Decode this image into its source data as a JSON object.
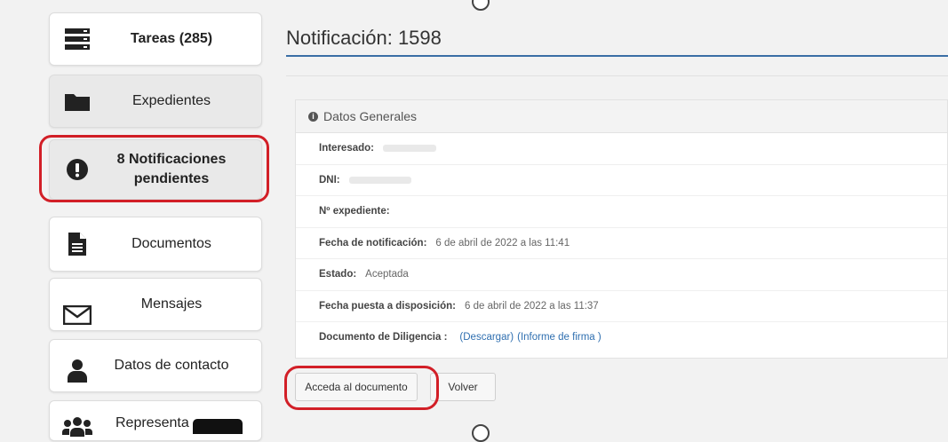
{
  "sidebar": {
    "items": [
      {
        "label": "Tareas (285)",
        "icon": "server-icon",
        "bold": true
      },
      {
        "label": "Expedientes",
        "icon": "folder-icon"
      },
      {
        "label": "8 Notificaciones pendientes",
        "icon": "exclamation-icon",
        "bold": true
      },
      {
        "label": "Documentos",
        "icon": "document-icon"
      },
      {
        "label": "Mensajes",
        "icon": "envelope-icon"
      },
      {
        "label": "Datos de contacto",
        "icon": "user-icon"
      },
      {
        "label": "Representa",
        "icon": "users-icon"
      }
    ]
  },
  "main": {
    "title": "Notificación: 1598",
    "panel_title": "Datos Generales",
    "fields": {
      "interesado_label": "Interesado:",
      "dni_label": "DNI:",
      "expediente_label": "Nº expediente:",
      "fecha_notif_label": "Fecha de notificación:",
      "fecha_notif_value": "6 de abril de 2022 a las 11:41",
      "estado_label": "Estado:",
      "estado_value": "Aceptada",
      "fecha_puesta_label": "Fecha puesta a disposición:",
      "fecha_puesta_value": "6 de abril de 2022 a las 11:37",
      "documento_label": "Documento de Diligencia :",
      "descargar_link": "(Descargar)",
      "informe_link": "(Informe de firma )"
    },
    "buttons": {
      "acceda": "Acceda al documento",
      "volver": "Volver"
    }
  },
  "colors": {
    "highlight": "#d21f27",
    "title_underline": "#3a6ea5",
    "link": "#2f6fb0"
  }
}
